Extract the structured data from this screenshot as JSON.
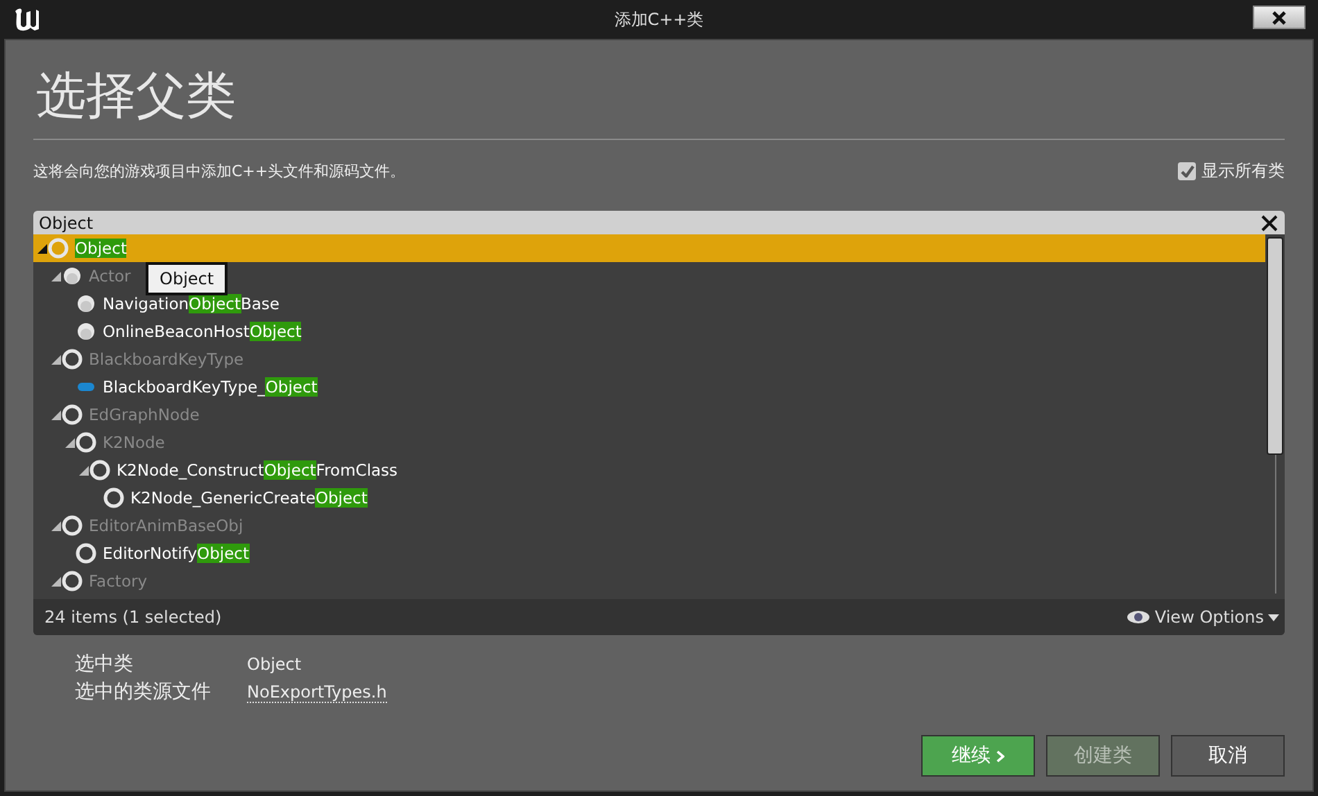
{
  "window": {
    "title": "添加C++类"
  },
  "heading": "选择父类",
  "description": "这将会向您的游戏项目中添加C++头文件和源码文件。",
  "show_all": {
    "label": "显示所有类",
    "checked": true
  },
  "search": {
    "value": "Object"
  },
  "tree": [
    {
      "match": "Object",
      "kind": "ring",
      "dimmed": false,
      "selected": true,
      "expanded": true,
      "children": [
        {
          "pre": "Actor",
          "kind": "ball",
          "dimmed": true,
          "selected": false,
          "expanded": true,
          "children": [
            {
              "pre": "Navigation",
              "match": "Object",
              "post": "Base",
              "kind": "ball",
              "dimmed": false,
              "selected": false
            },
            {
              "pre": "OnlineBeaconHost",
              "match": "Object",
              "kind": "ball",
              "dimmed": false,
              "selected": false
            }
          ]
        },
        {
          "pre": "BlackboardKeyType",
          "kind": "ring",
          "dimmed": true,
          "selected": false,
          "expanded": true,
          "children": [
            {
              "pre": "BlackboardKeyType_",
              "match": "Object",
              "kind": "pill",
              "dimmed": false,
              "selected": false
            }
          ]
        },
        {
          "pre": "EdGraphNode",
          "kind": "ring",
          "dimmed": true,
          "selected": false,
          "expanded": true,
          "children": [
            {
              "pre": "K2Node",
              "kind": "ring",
              "dimmed": true,
              "selected": false,
              "expanded": true,
              "children": [
                {
                  "pre": "K2Node_Construct",
                  "match": "Object",
                  "post": "FromClass",
                  "kind": "ring",
                  "dimmed": false,
                  "selected": false,
                  "expanded": true,
                  "children": [
                    {
                      "pre": "K2Node_GenericCreate",
                      "match": "Object",
                      "kind": "ring",
                      "dimmed": false,
                      "selected": false
                    }
                  ]
                }
              ]
            }
          ]
        },
        {
          "pre": "EditorAnimBaseObj",
          "kind": "ring",
          "dimmed": true,
          "selected": false,
          "expanded": true,
          "children": [
            {
              "pre": "EditorNotify",
              "match": "Object",
              "kind": "ring",
              "dimmed": false,
              "selected": false
            }
          ]
        },
        {
          "pre": "Factory",
          "kind": "ring",
          "dimmed": true,
          "selected": false,
          "expanded": true
        }
      ]
    }
  ],
  "tooltip": "Object",
  "status": "24 items (1 selected)",
  "view_options": "View Options",
  "details": [
    {
      "label": "选中类",
      "value": "Object",
      "link": false
    },
    {
      "label": "选中的类源文件",
      "value": "NoExportTypes.h",
      "link": true
    }
  ],
  "buttons": [
    {
      "label": "继续",
      "kind": "primary",
      "disabled": false
    },
    {
      "label": "创建类",
      "kind": "primary",
      "disabled": true
    },
    {
      "label": "取消",
      "kind": "plain",
      "disabled": false
    }
  ]
}
